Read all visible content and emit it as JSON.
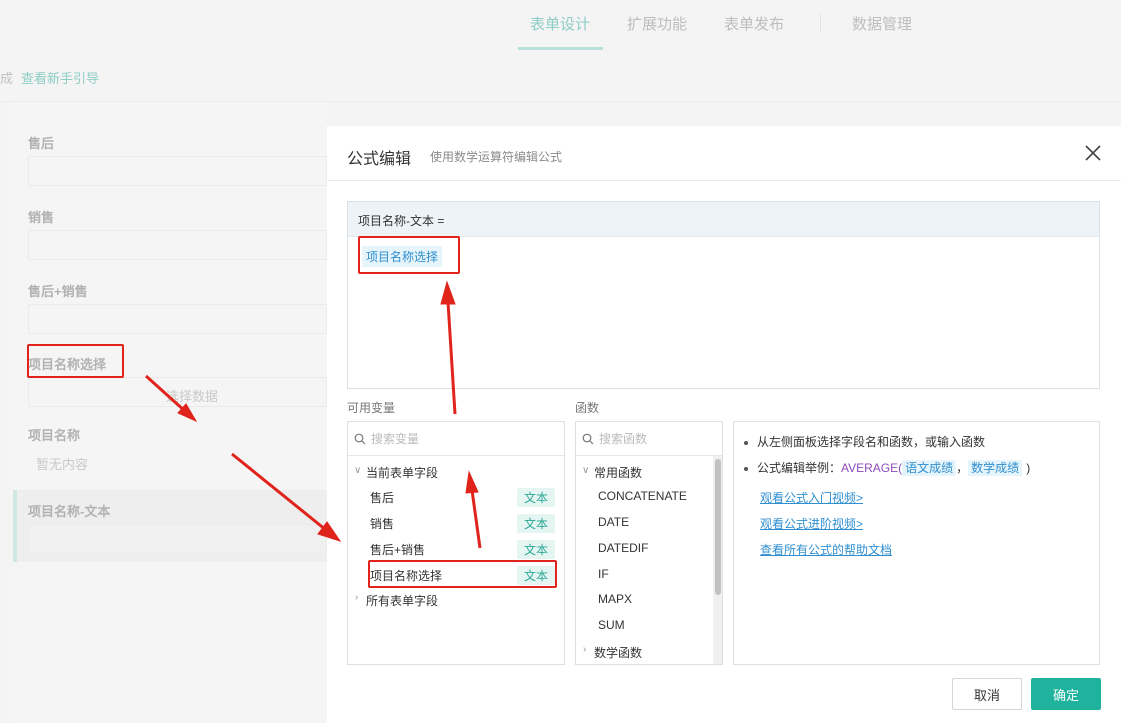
{
  "nav": {
    "tabs": [
      {
        "label": "表单设计",
        "active": true
      },
      {
        "label": "扩展功能",
        "active": false
      },
      {
        "label": "表单发布",
        "active": false
      },
      {
        "label": "数据管理",
        "active": false
      }
    ]
  },
  "guide": {
    "prefix": "成",
    "link": "查看新手引导"
  },
  "form": {
    "fields": [
      {
        "label": "售后",
        "placeholder": ""
      },
      {
        "label": "销售",
        "placeholder": ""
      },
      {
        "label": "售后+销售",
        "placeholder": ""
      },
      {
        "label": "项目名称选择",
        "placeholder": "选择数据"
      },
      {
        "label": "项目名称",
        "placeholder": "暂无内容"
      },
      {
        "label": "项目名称-文本",
        "placeholder": ""
      }
    ]
  },
  "dialog": {
    "title": "公式编辑",
    "subtitle": "使用数学运算符编辑公式",
    "editor_header": "项目名称-文本 =",
    "formula_chip": "项目名称选择",
    "variables": {
      "section_label": "可用变量",
      "search_placeholder": "搜索变量",
      "group_current": "当前表单字段",
      "items": [
        {
          "label": "售后",
          "tag": "文本"
        },
        {
          "label": "销售",
          "tag": "文本"
        },
        {
          "label": "售后+销售",
          "tag": "文本"
        },
        {
          "label": "项目名称选择",
          "tag": "文本"
        }
      ],
      "group_all": "所有表单字段"
    },
    "functions": {
      "section_label": "函数",
      "search_placeholder": "搜索函数",
      "group_common": "常用函数",
      "items": [
        "CONCATENATE",
        "DATE",
        "DATEDIF",
        "IF",
        "MAPX",
        "SUM"
      ],
      "group_math": "数学函数"
    },
    "help": {
      "line1": "从左侧面板选择字段名和函数，或输入函数",
      "example_prefix": "公式编辑举例：",
      "example_fn": "AVERAGE(",
      "example_arg1": "语文成绩",
      "example_sep": "，",
      "example_arg2": "数学成绩",
      "example_close": ")",
      "links": [
        "观看公式入门视频>",
        "观看公式进阶视频>",
        "查看所有公式的帮助文档"
      ]
    },
    "buttons": {
      "cancel": "取消",
      "ok": "确定"
    }
  },
  "colors": {
    "accent": "#1fb39e",
    "link": "#2f8fd0",
    "annotation": "#e0241b"
  }
}
